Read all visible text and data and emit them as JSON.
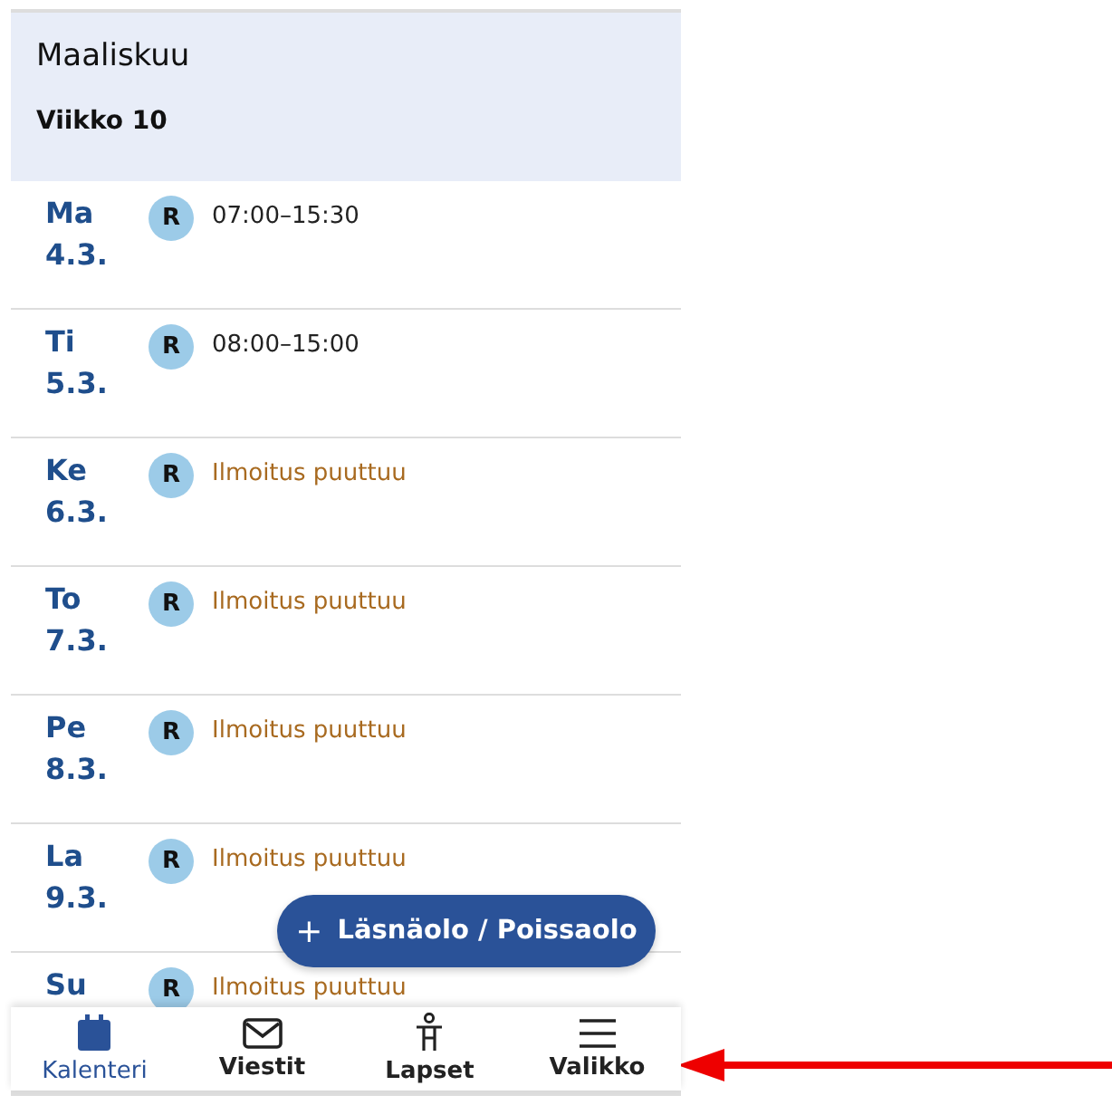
{
  "header": {
    "month": "Maaliskuu",
    "week": "Viikko 10"
  },
  "days": [
    {
      "day": "Ma",
      "date": "4.3.",
      "badge": "R",
      "kind": "reservation",
      "text": "07:00–15:30"
    },
    {
      "day": "Ti",
      "date": "5.3.",
      "badge": "R",
      "kind": "reservation",
      "text": "08:00–15:00"
    },
    {
      "day": "Ke",
      "date": "6.3.",
      "badge": "R",
      "kind": "missing",
      "text": "Ilmoitus puuttuu"
    },
    {
      "day": "To",
      "date": "7.3.",
      "badge": "R",
      "kind": "missing",
      "text": "Ilmoitus puuttuu"
    },
    {
      "day": "Pe",
      "date": "8.3.",
      "badge": "R",
      "kind": "missing",
      "text": "Ilmoitus puuttuu"
    },
    {
      "day": "La",
      "date": "9.3.",
      "badge": "R",
      "kind": "missing",
      "text": "Ilmoitus puuttuu"
    },
    {
      "day": "Su",
      "badge": "R",
      "kind": "missing",
      "text": "Ilmoitus puuttuu"
    }
  ],
  "fab": {
    "icon": "+",
    "label": "Läsnäolo / Poissaolo"
  },
  "nav": [
    {
      "kind": "calendar",
      "label": "Kalenteri",
      "selected": true
    },
    {
      "kind": "mail",
      "label": "Viestit",
      "selected": false
    },
    {
      "kind": "child",
      "label": "Lapset",
      "selected": false
    },
    {
      "kind": "menu",
      "label": "Valikko",
      "selected": false
    }
  ]
}
